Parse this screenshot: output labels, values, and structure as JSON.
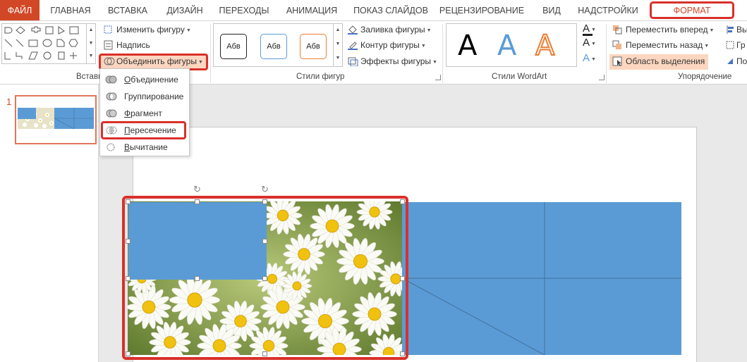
{
  "tabs": {
    "file": "ФАЙЛ",
    "home": "ГЛАВНАЯ",
    "insert": "ВСТАВКА",
    "design": "ДИЗАЙН",
    "transitions": "ПЕРЕХОДЫ",
    "animations": "АНИМАЦИЯ",
    "slideshow": "ПОКАЗ СЛАЙДОВ",
    "review": "РЕЦЕНЗИРОВАНИЕ",
    "view": "ВИД",
    "addins": "НАДСТРОЙКИ",
    "format": "ФОРМАТ"
  },
  "ribbon": {
    "insert_shapes": {
      "group_label": "Вставка",
      "edit_shape": "Изменить фигуру",
      "text_box": "Надпись",
      "merge_shapes": "Объединить фигуры"
    },
    "shape_styles": {
      "group_label": "Стили фигур",
      "preset_text": "Абв",
      "fill": "Заливка фигуры",
      "outline": "Контур фигуры",
      "effects": "Эффекты фигуры"
    },
    "wordart": {
      "group_label": "Стили WordArt",
      "letter": "A"
    },
    "arrange": {
      "group_label": "Упорядочение",
      "bring_forward": "Переместить вперед",
      "send_backward": "Переместить назад",
      "selection_pane": "Область выделения",
      "align_cut": "Вы",
      "group_cut": "Гр",
      "rotate_cut": "По"
    }
  },
  "merge_menu": {
    "items": [
      {
        "accel": "О",
        "rest": "бъединение"
      },
      {
        "accel": "",
        "rest": "Группирование"
      },
      {
        "accel": "Ф",
        "rest": "рагмент"
      },
      {
        "accel": "П",
        "rest": "ересечение"
      },
      {
        "accel": "В",
        "rest": "ычитание"
      }
    ],
    "highlighted": "Пересечение"
  },
  "slides_panel": {
    "slide_number": "1"
  },
  "colors": {
    "accent": "#d24726",
    "highlight_red": "#d9302a",
    "shape_blue": "#5b9bd5",
    "hover_orange": "#fcd6c0"
  }
}
